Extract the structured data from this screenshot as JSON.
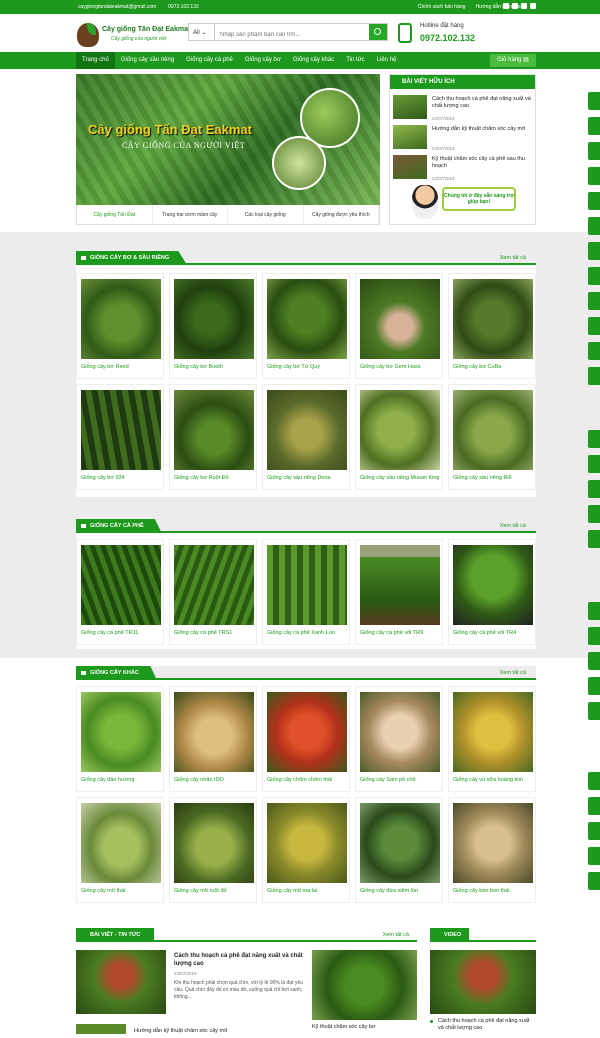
{
  "topbar": {
    "email": "caygiongtandateakmat@gmail.com",
    "phone": "0972.102.132",
    "links": [
      "Chính sách bán hàng",
      "Hướng dẫn thanh toán"
    ]
  },
  "logo": {
    "name": "Cây giống Tân Đạt Eakmat",
    "slogan": "Cây giống của người việt"
  },
  "search": {
    "category": "All",
    "placeholder": "Nhập sản phẩm bạn cần tìm..."
  },
  "hotline": {
    "label": "Hotline đặt hàng",
    "number": "0972.102.132"
  },
  "nav": {
    "items": [
      "Trang chủ",
      "Giống cây sầu riêng",
      "Giống cây cà phê",
      "Giống cây bơ",
      "Giống cây khác",
      "Tin tức",
      "Liên hệ"
    ],
    "cart": "Giỏ hàng"
  },
  "banner": {
    "title": "Cây giống Tấn Đạt Eakmat",
    "subtitle": "CÂY GIỐNG CỦA NGƯỜI VIỆT",
    "tabs": [
      "Cây giống Tấn Đạt",
      "Trang trại ươm mầm cây",
      "Các loại cây giống",
      "Cây giống được yêu thích"
    ]
  },
  "useful": {
    "title": "BÀI VIẾT HỮU ÍCH",
    "items": [
      {
        "title": "Cách thu hoạch cà phê đạt năng xuất và chất lượng cao",
        "date": "24/07/2019"
      },
      {
        "title": "Hướng dẫn kỹ thuật chăm sóc cây mít",
        "date": "24/07/2019"
      },
      {
        "title": "Kỹ thuật chăm sóc cây cà phê sau thu hoạch",
        "date": "24/07/2019"
      }
    ],
    "support": "Chúng tôi ở đây sẵn sàng trợ giúp bạn!"
  },
  "sections": [
    {
      "title": "GIỐNG CÂY BƠ & SẦU RIÊNG",
      "more": "Xem tất cả",
      "products": [
        "Giống cây bơ Reed",
        "Giống cây bơ Booth",
        "Giống cây bơ Tứ Quý",
        "Giống cây bơ Gem Hass",
        "Giống cây bơ CuBa",
        "Giống cây bơ 034",
        "Giống cây bơ Ruột Đỏ",
        "Giống cây sầu riêng Dona",
        "Giống cây sầu riêng Musan King",
        "Giống cây sầu riêng Ri6"
      ]
    },
    {
      "title": "GIỐNG CÂY CÀ PHÊ",
      "more": "Xem tất cả",
      "products": [
        "Giống cây cà phê TR11",
        "Giống cây cà phê TRS1",
        "Giống cây cà phê Xanh Lùn",
        "Giống cây cà phê vối TR9",
        "Giống cây cà phê vối TR4"
      ]
    },
    {
      "title": "GIỐNG CÂY KHÁC",
      "more": "Xem tất cả",
      "products": [
        "Giống cây đàn hương",
        "Giống cây nhãn IDO",
        "Giống cây chôm chôm thái",
        "Giống cây Sam pô chê",
        "Giống cây vú sữa hoàng kim",
        "Giống cây mít thái",
        "Giống cây mít ruột đỏ",
        "Giống cây mít ma lai",
        "Giống cây dừa xiêm lùn",
        "Giống cây bòn bon thái"
      ]
    }
  ],
  "blog": {
    "title": "BÀI VIẾT - TIN TỨC",
    "more": "Xem tất cả",
    "main_title": "Cách thu hoạch cà phê đạt năng xuất và chất lượng cao",
    "main_date": "24/07/2019",
    "main_excerpt": "Khi thu hoạch phải chọn quả chín, với tỷ lệ 90% là đạt yêu cầu. Quả chín đầy đủ có màu đỏ, cuống quả chỉ hơi xanh, không...",
    "second_title": "Hướng dẫn kỹ thuật chăm sóc cây mít",
    "side_title": "Kỹ thuật chăm sóc cây bơ"
  },
  "video": {
    "title": "VIDEO",
    "caption": "Cách thu hoạch cà phê đạt năng xuất và chất lượng cao"
  },
  "colors": {
    "brand": "#1d9a1d",
    "brand_dark": "#117511",
    "accent": "#f3d21e"
  }
}
